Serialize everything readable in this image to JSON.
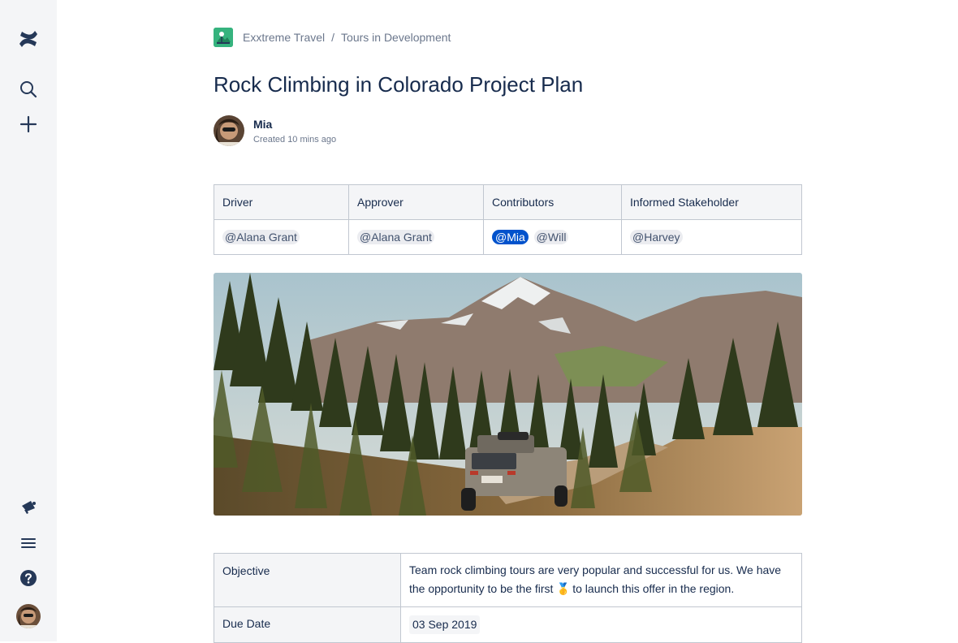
{
  "sidebar": {
    "logo_icon": "confluence-logo-icon",
    "top_items": [
      {
        "icon": "search-icon"
      },
      {
        "icon": "plus-icon"
      }
    ],
    "bottom_items": [
      {
        "icon": "megaphone-icon"
      },
      {
        "icon": "menu-icon"
      },
      {
        "icon": "help-icon"
      },
      {
        "icon": "user-avatar"
      }
    ]
  },
  "breadcrumb": {
    "space_icon": "space-logo-icon",
    "space": "Exxtreme Travel",
    "separator": "/",
    "page": "Tours in Development"
  },
  "page": {
    "title": "Rock Climbing in Colorado Project Plan",
    "author": "Mia",
    "created": "Created 10 mins ago"
  },
  "roles_table": {
    "headers": [
      "Driver",
      "Approver",
      "Contributors",
      "Informed Stakeholder"
    ],
    "driver": "@Alana Grant",
    "approver": "@Alana Grant",
    "contributors": [
      "@Mia",
      "@Will"
    ],
    "stakeholder": "@Harvey"
  },
  "hero_image": {
    "description": "mountain-landscape-with-suv"
  },
  "details_table": {
    "objective_label": "Objective",
    "objective_text_1": "Team rock climbing tours are very popular and successful for us. We have the opportunity to be the first",
    "objective_emoji": "🥇",
    "objective_text_2": "to launch this offer in the region.",
    "due_label": "Due Date",
    "due_value": "03 Sep 2019"
  },
  "colors": {
    "accent": "#0052cc",
    "sidebar_bg": "#f4f5f7",
    "text": "#172b4d",
    "subtle": "#6b778c"
  }
}
